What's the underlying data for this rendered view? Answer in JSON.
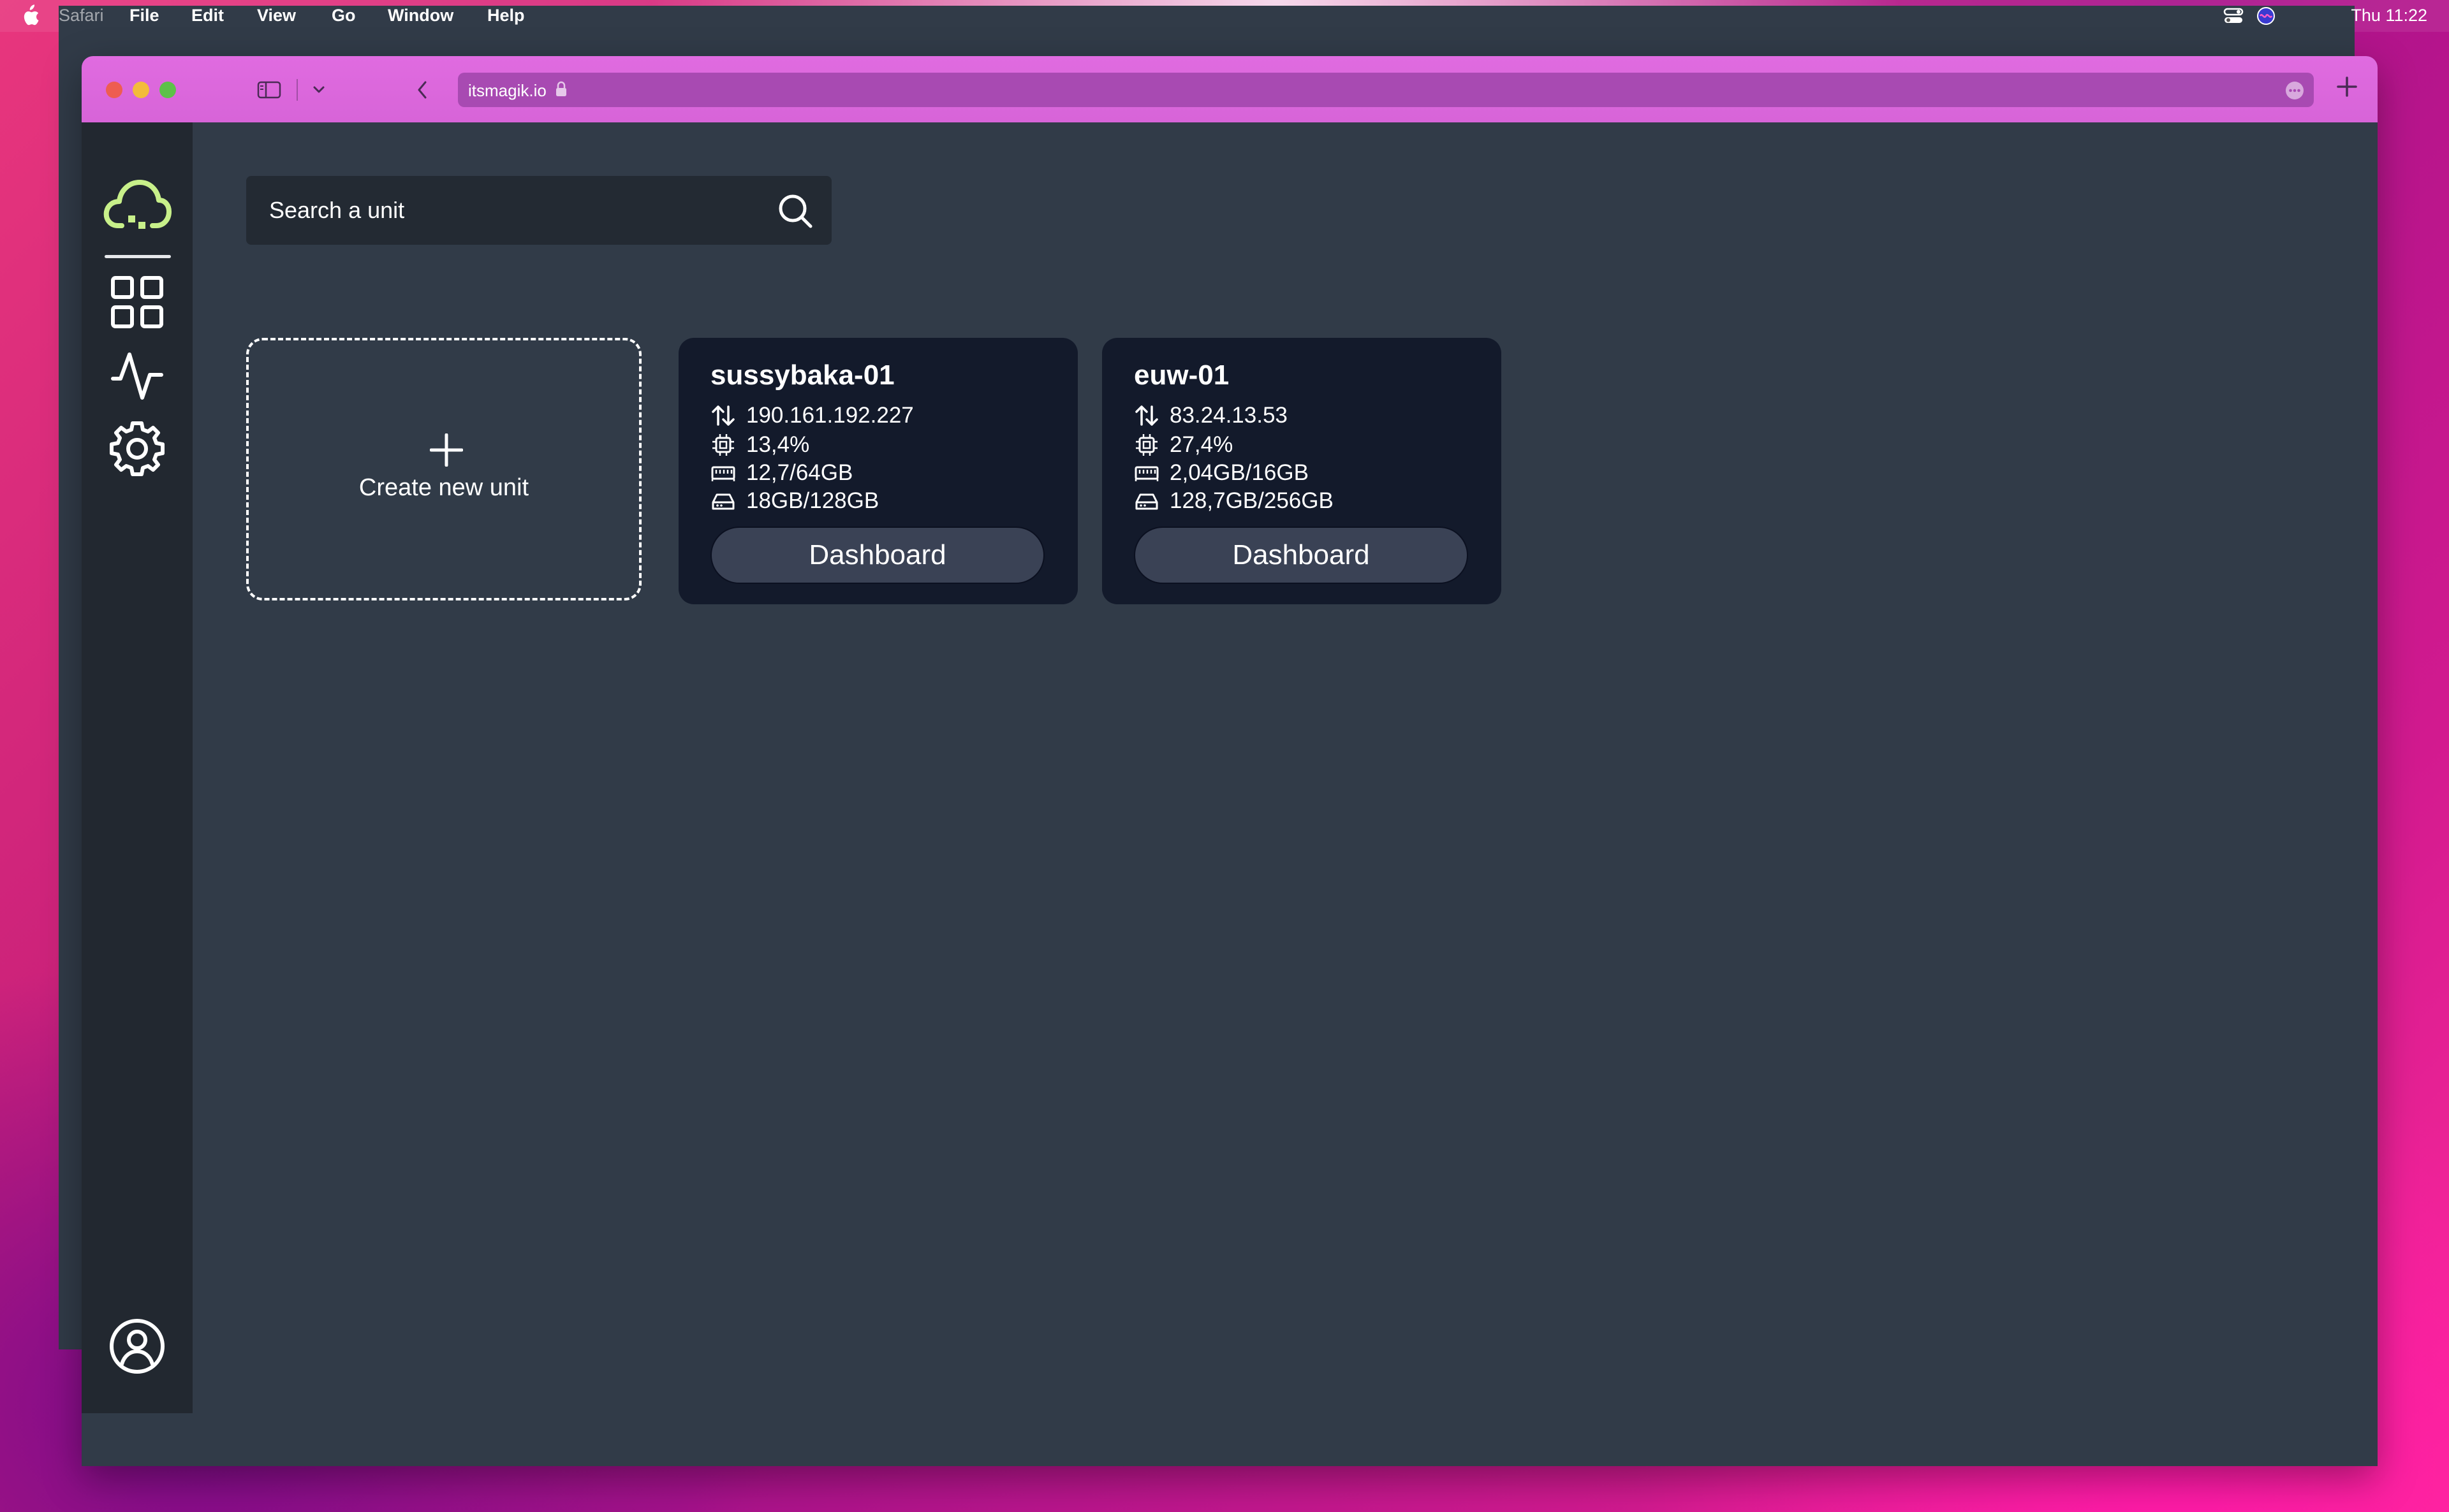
{
  "menubar": {
    "app": "Safari",
    "items": [
      "File",
      "Edit",
      "View",
      "Go",
      "Window",
      "Help"
    ],
    "clock": "Thu 11:22"
  },
  "browser": {
    "url": "itsmagik.io"
  },
  "sidebar": {
    "items": [
      {
        "icon": "cloud-icon",
        "active": true
      },
      {
        "icon": "grid-icon"
      },
      {
        "icon": "activity-icon"
      },
      {
        "icon": "gear-icon"
      }
    ],
    "bottom": {
      "icon": "user-icon"
    },
    "accent_color": "#c8f08a"
  },
  "search": {
    "placeholder": "Search a unit"
  },
  "create_card": {
    "label": "Create new unit"
  },
  "units": [
    {
      "name": "sussybaka-01",
      "ip": "190.161.192.227",
      "cpu": "13,4%",
      "ram": "12,7/64GB",
      "disk": "18GB/128GB",
      "button": "Dashboard"
    },
    {
      "name": "euw-01",
      "ip": "83.24.13.53",
      "cpu": "27,4%",
      "ram": "2,04GB/16GB",
      "disk": "128,7GB/256GB",
      "button": "Dashboard"
    }
  ]
}
